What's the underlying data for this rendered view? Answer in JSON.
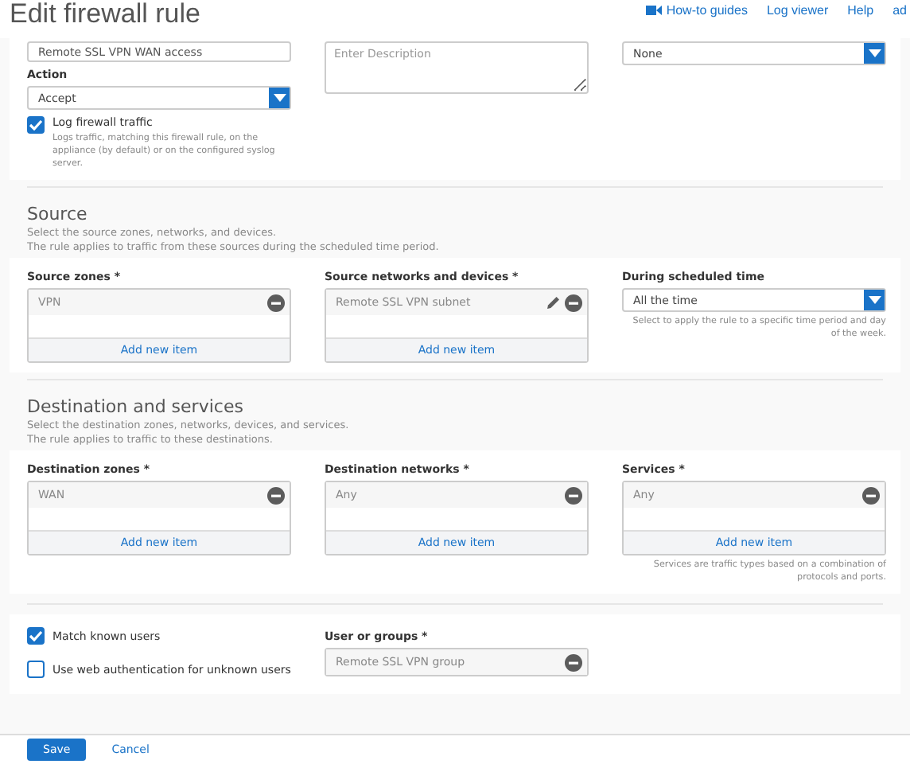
{
  "header": {
    "title": "Edit firewall rule",
    "links": [
      {
        "label": "How-to guides",
        "kind": "video"
      },
      {
        "label": "Log viewer",
        "kind": "text"
      },
      {
        "label": "Help",
        "kind": "text"
      },
      {
        "label": "ad",
        "kind": "text"
      }
    ]
  },
  "general": {
    "rule_name": {
      "value": "Remote SSL VPN WAN access"
    },
    "action": {
      "label": "Action",
      "value": "Accept"
    },
    "log_traffic": {
      "label": "Log firewall traffic",
      "checked": true,
      "hint": "Logs traffic, matching this firewall rule, on the appliance (by default) or on the configured syslog server."
    },
    "description": {
      "placeholder": "Enter Description"
    },
    "column_3": {
      "value": "None"
    }
  },
  "sections": [
    {
      "heading": "Source",
      "description": [
        "Select the source zones, networks, and devices.",
        "The rule applies to traffic from these sources during the scheduled time period."
      ],
      "fields": [
        {
          "kind": "list",
          "label": "Source zones *",
          "items": [
            {
              "text": "VPN",
              "editable": false
            }
          ],
          "add": "Add new item"
        },
        {
          "kind": "list",
          "label": "Source networks and devices *",
          "items": [
            {
              "text": "Remote SSL VPN subnet",
              "editable": true
            }
          ],
          "add": "Add new item"
        },
        {
          "kind": "select",
          "label": "During scheduled time",
          "value": "All the time",
          "hint": "Select to apply the rule to a specific time period and day of the week."
        }
      ]
    },
    {
      "heading": "Destination and services",
      "description": [
        "Select the destination zones, networks, devices, and services.",
        "The rule applies to traffic to these destinations."
      ],
      "fields": [
        {
          "kind": "list",
          "label": "Destination zones *",
          "items": [
            {
              "text": "WAN",
              "editable": false
            }
          ],
          "add": "Add new item"
        },
        {
          "kind": "list",
          "label": "Destination networks *",
          "items": [
            {
              "text": "Any",
              "editable": false
            }
          ],
          "add": "Add new item"
        },
        {
          "kind": "list",
          "label": "Services *",
          "items": [
            {
              "text": "Any",
              "editable": false
            }
          ],
          "add": "Add new item",
          "hint": "Services are traffic types based on a combination of protocols and ports."
        }
      ]
    }
  ],
  "identity": {
    "checkboxes": [
      {
        "label": "Match known users",
        "checked": true
      },
      {
        "label": "Use web authentication for unknown users",
        "checked": false
      }
    ],
    "field": {
      "label": "User or groups *",
      "items": [
        {
          "text": "Remote SSL VPN group",
          "editable": false
        }
      ]
    }
  },
  "footer": {
    "buttons": [
      {
        "label": "Save",
        "kind": "primary"
      },
      {
        "label": "Cancel",
        "kind": "link"
      }
    ]
  }
}
